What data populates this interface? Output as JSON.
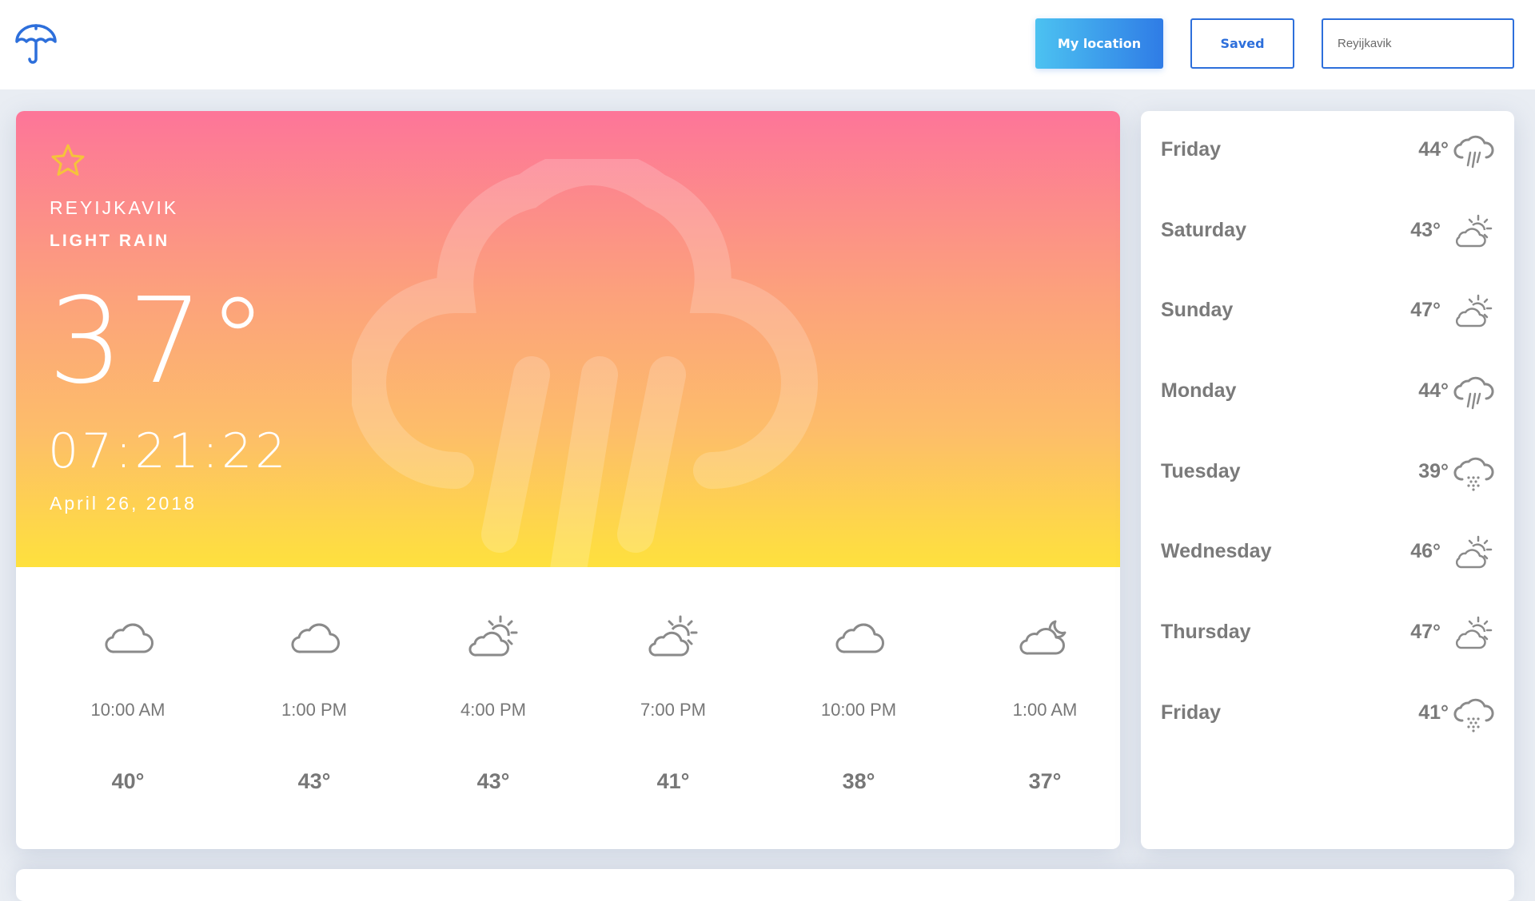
{
  "header": {
    "my_location_label": "My location",
    "saved_label": "Saved",
    "search_value": "Reyijkavik"
  },
  "current": {
    "city": "REYIJKAVIK",
    "condition": "LIGHT RAIN",
    "temperature": "37°",
    "time": "07:21:22",
    "date": "April 26, 2018",
    "icon": "rain-cloud-icon"
  },
  "hourly": [
    {
      "time": "10:00 AM",
      "temp": "40°",
      "icon": "cloud-icon"
    },
    {
      "time": "1:00 PM",
      "temp": "43°",
      "icon": "cloud-icon"
    },
    {
      "time": "4:00 PM",
      "temp": "43°",
      "icon": "partly-sunny-icon"
    },
    {
      "time": "7:00 PM",
      "temp": "41°",
      "icon": "partly-sunny-icon"
    },
    {
      "time": "10:00 PM",
      "temp": "38°",
      "icon": "cloud-icon"
    },
    {
      "time": "1:00 AM",
      "temp": "37°",
      "icon": "cloudy-night-icon"
    }
  ],
  "daily": [
    {
      "day": "Friday",
      "temp": "44°",
      "icon": "rain-icon"
    },
    {
      "day": "Saturday",
      "temp": "43°",
      "icon": "partly-sunny-icon"
    },
    {
      "day": "Sunday",
      "temp": "47°",
      "icon": "partly-sunny-icon"
    },
    {
      "day": "Monday",
      "temp": "44°",
      "icon": "rain-icon"
    },
    {
      "day": "Tuesday",
      "temp": "39°",
      "icon": "snow-icon"
    },
    {
      "day": "Wednesday",
      "temp": "46°",
      "icon": "partly-sunny-icon"
    },
    {
      "day": "Thursday",
      "temp": "47°",
      "icon": "partly-sunny-icon"
    },
    {
      "day": "Friday",
      "temp": "41°",
      "icon": "snow-icon"
    }
  ],
  "colors": {
    "accent": "#2d6fdb",
    "gradient_top": "#fd7599",
    "gradient_bottom": "#fee13d",
    "star": "#f5c33b"
  }
}
